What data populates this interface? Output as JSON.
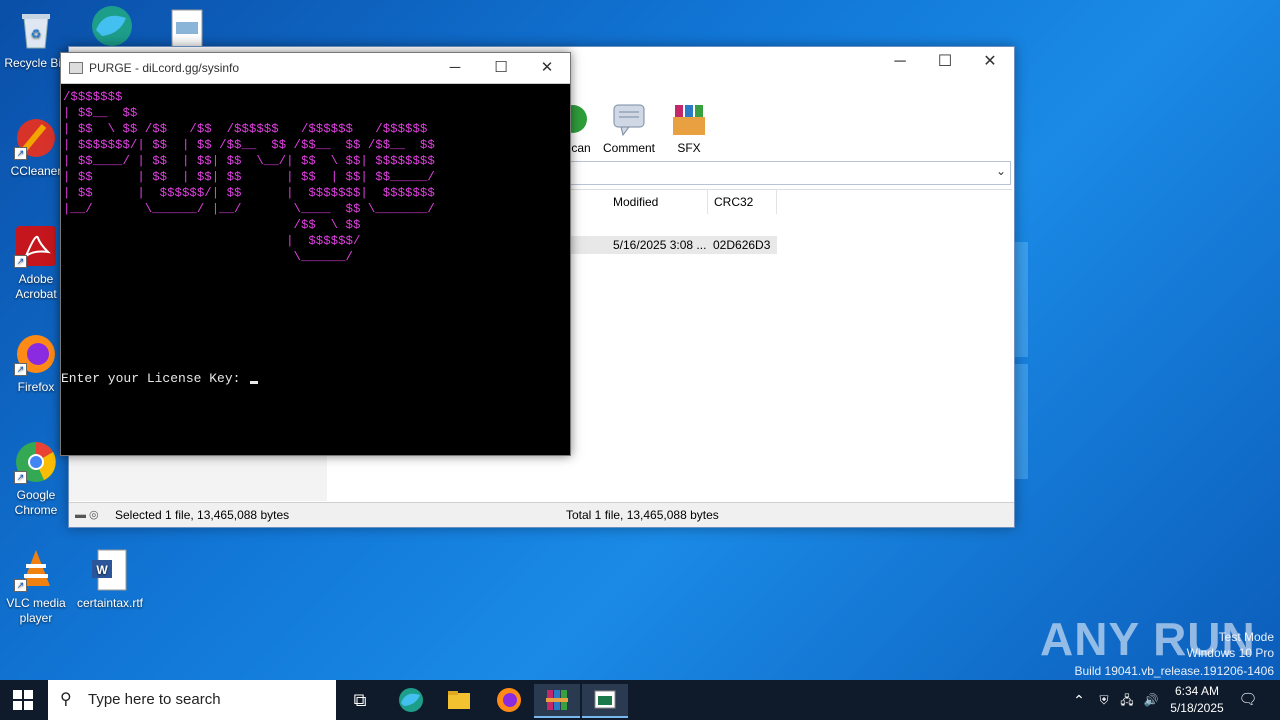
{
  "desktop": {
    "icons": [
      {
        "label": "Recycle Bin",
        "icon": "recycle-bin-icon"
      },
      {
        "label": "CCleaner",
        "icon": "ccleaner-icon"
      },
      {
        "label": "Adobe Acrobat",
        "icon": "adobe-acrobat-icon"
      },
      {
        "label": "Firefox",
        "icon": "firefox-icon"
      },
      {
        "label": "Google Chrome",
        "icon": "chrome-icon"
      },
      {
        "label": "VLC media player",
        "icon": "vlc-icon"
      },
      {
        "label": "certaintax.rtf",
        "icon": "word-document-icon"
      }
    ]
  },
  "winrar": {
    "toolbar": [
      {
        "label": "Scan",
        "icon": "scan-icon"
      },
      {
        "label": "Comment",
        "icon": "comment-icon"
      },
      {
        "label": "SFX",
        "icon": "sfx-icon"
      }
    ],
    "columns": [
      "Modified",
      "CRC32"
    ],
    "rows": [
      {
        "modified": "5/16/2025 3:08 ...",
        "crc32": "02D626D3"
      }
    ],
    "status_left": "Selected 1 file, 13,465,088 bytes",
    "status_right": "Total 1 file, 13,465,088 bytes"
  },
  "console": {
    "title": "PURGE - diLcord.gg/sysinfo",
    "ascii_art": "/$$$$$$$\n| $$__  $$\n| $$  \\ $$ /$$   /$$  /$$$$$$   /$$$$$$   /$$$$$$\n| $$$$$$$/| $$  | $$ /$$__  $$ /$$__  $$ /$$__  $$\n| $$____/ | $$  | $$| $$  \\__/| $$  \\ $$| $$$$$$$$\n| $$      | $$  | $$| $$      | $$  | $$| $$_____/\n| $$      |  $$$$$$/| $$      |  $$$$$$$|  $$$$$$$\n|__/       \\______/ |__/       \\____  $$ \\_______/\n                               /$$  \\ $$\n                              |  $$$$$$/\n                               \\______/",
    "prompt": "Enter your License Key: ",
    "ascii_color": "#e040e0"
  },
  "taskbar": {
    "search_placeholder": "Type here to search",
    "time": "6:34 AM",
    "date": "5/18/2025"
  },
  "watermark": {
    "brand": "ANY RUN",
    "line1": "Test Mode",
    "line2": "Windows 10 Pro",
    "line3": "Build 19041.vb_release.191206-1406"
  }
}
